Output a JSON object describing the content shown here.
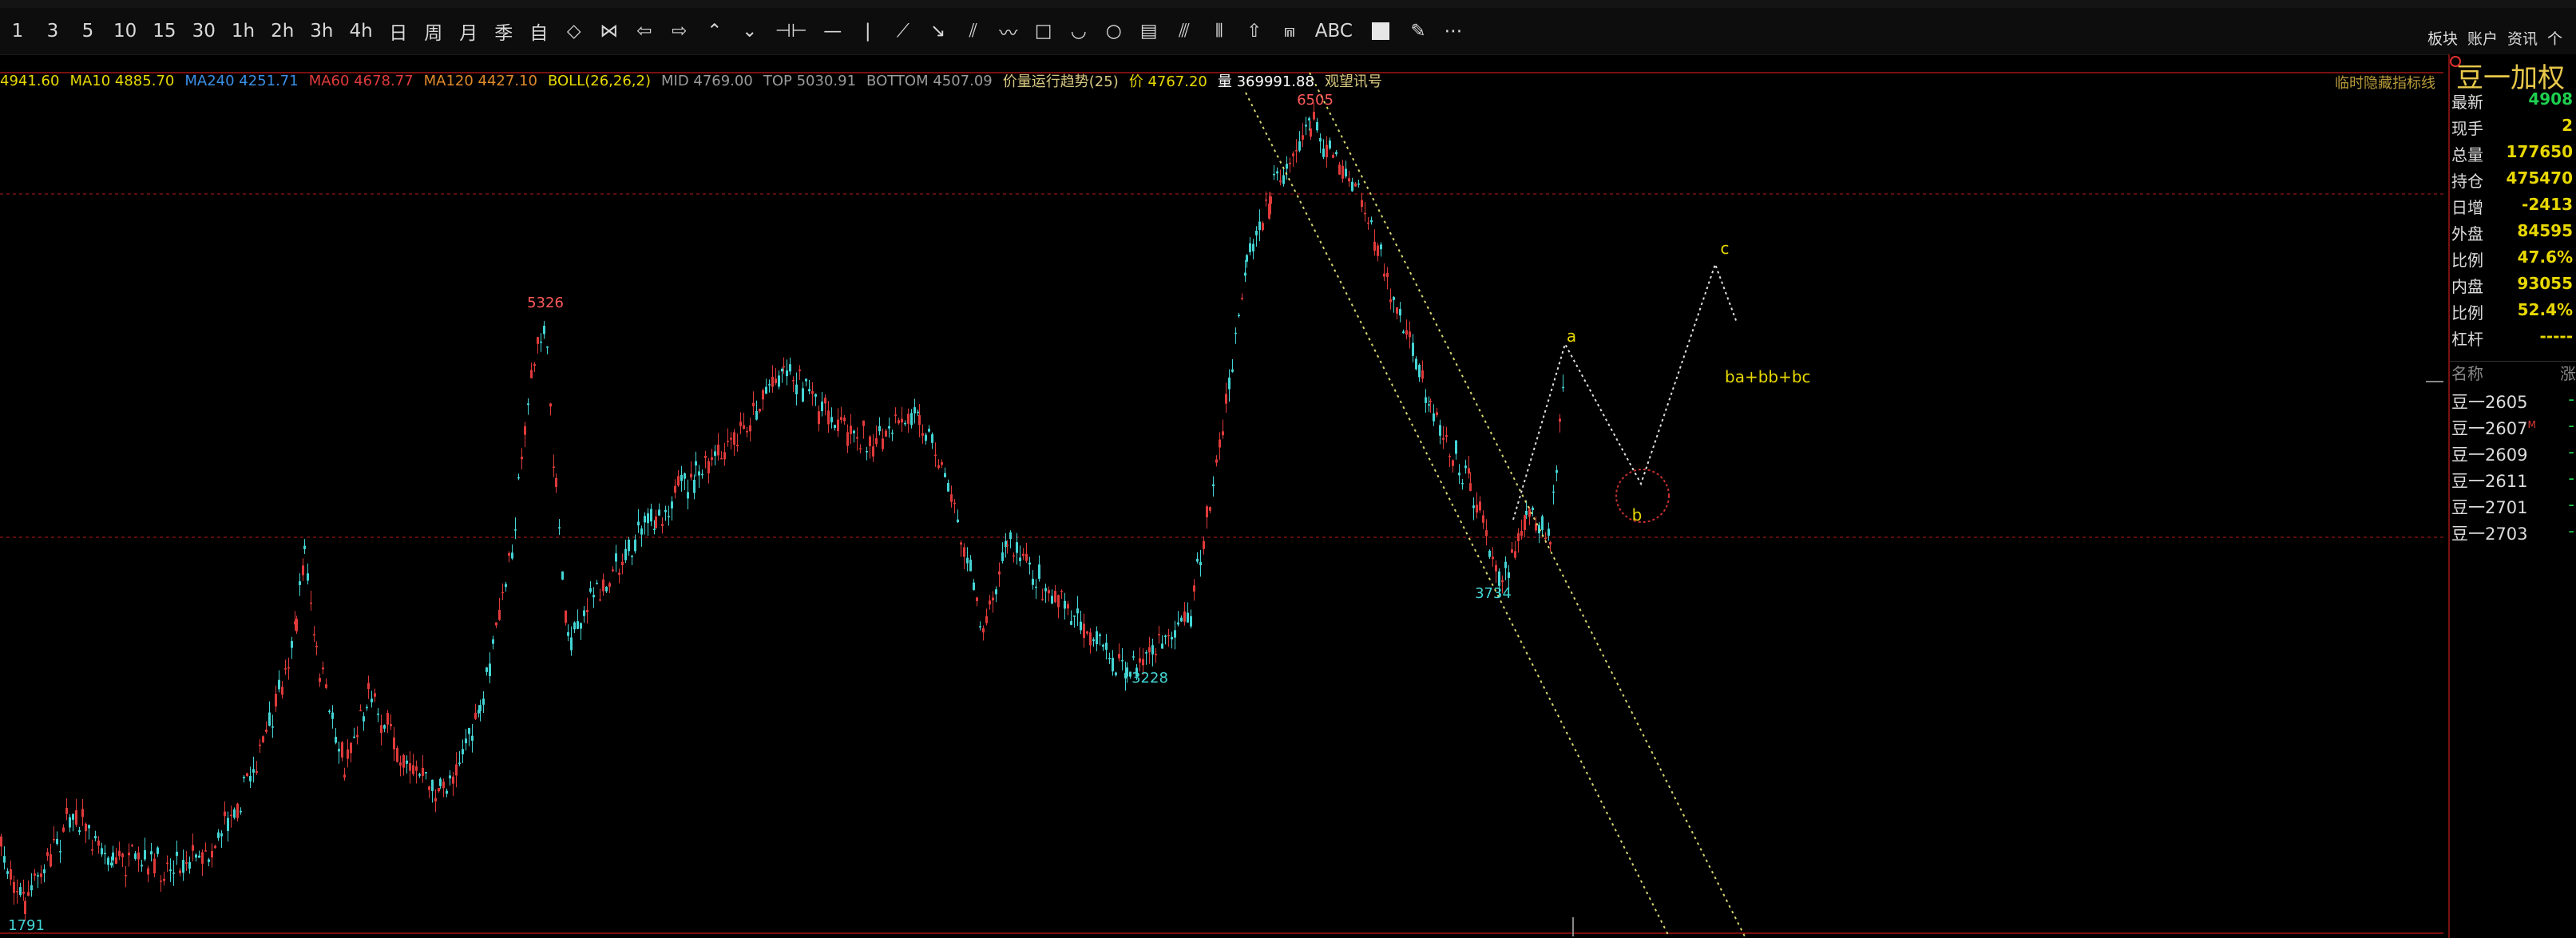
{
  "toolbar": {
    "periods": [
      "1",
      "3",
      "5",
      "10",
      "15",
      "30",
      "1h",
      "2h",
      "3h",
      "4h",
      "日",
      "周",
      "月",
      "季",
      "自"
    ],
    "right": [
      "板块",
      "账户",
      "资讯",
      "个"
    ]
  },
  "indicators": [
    {
      "text": "4941.60",
      "color": "#e8d800"
    },
    {
      "text": "MA10 4885.70",
      "color": "#e8d800"
    },
    {
      "text": "MA240 4251.71",
      "color": "#3a8fe6"
    },
    {
      "text": "MA60 4678.77",
      "color": "#e03a3a"
    },
    {
      "text": "MA120 4427.10",
      "color": "#e08a2a"
    },
    {
      "text": "BOLL(26,26,2)",
      "color": "#e8d800"
    },
    {
      "text": "MID 4769.00",
      "color": "#9a9a9a"
    },
    {
      "text": "TOP 5030.91",
      "color": "#9a9a9a"
    },
    {
      "text": "BOTTOM 4507.09",
      "color": "#9a9a9a"
    },
    {
      "text": "价量运行趋势(25)",
      "color": "#d8c880"
    },
    {
      "text": "价 4767.20",
      "color": "#e8d800"
    },
    {
      "text": "量 369991.88",
      "color": "#ffffff"
    },
    {
      "text": "观望讯号",
      "color": "#d8c880"
    }
  ],
  "hide_label": "临时隐藏指标线",
  "chart_labels": {
    "peak1": "5326",
    "peak2": "6505",
    "low1": "1791",
    "low2": "3228",
    "low3": "3734",
    "wave_a": "a",
    "wave_b": "b",
    "wave_c": "c",
    "wave_note": "ba+bb+bc"
  },
  "side": {
    "title": "豆一加权",
    "quotes": [
      {
        "k": "最新",
        "v": "4908",
        "c": "#1fcf4f"
      },
      {
        "k": "现手",
        "v": "2",
        "c": "#e8d800"
      },
      {
        "k": "总量",
        "v": "177650",
        "c": "#e8d800"
      },
      {
        "k": "持仓",
        "v": "475470",
        "c": "#e8d800"
      },
      {
        "k": "日增",
        "v": "-2413",
        "c": "#e8d800"
      },
      {
        "k": "外盘",
        "v": "84595",
        "c": "#e8d800"
      },
      {
        "k": "比例",
        "v": "47.6%",
        "c": "#e8d800"
      },
      {
        "k": "内盘",
        "v": "93055",
        "c": "#e8d800"
      },
      {
        "k": "比例",
        "v": "52.4%",
        "c": "#e8d800"
      },
      {
        "k": "杠杆",
        "v": "-----",
        "c": "#e8d800"
      }
    ],
    "list_header": "名称",
    "list_header2": "涨",
    "contracts": [
      {
        "name": "豆一2605",
        "flag": "",
        "d": "-"
      },
      {
        "name": "豆一2607",
        "flag": "M",
        "d": "-"
      },
      {
        "name": "豆一2609",
        "flag": "",
        "d": "-"
      },
      {
        "name": "豆一2611",
        "flag": "",
        "d": "-"
      },
      {
        "name": "豆一2701",
        "flag": "",
        "d": "-"
      },
      {
        "name": "豆一2703",
        "flag": "",
        "d": "-"
      }
    ]
  },
  "colors": {
    "up": "#e03a3a",
    "down": "#44d4d4",
    "accent": "#e8c84a"
  }
}
